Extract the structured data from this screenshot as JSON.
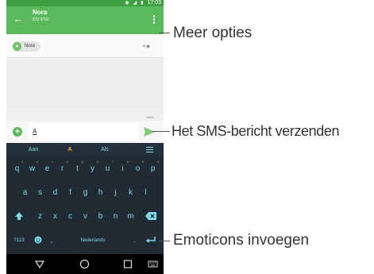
{
  "status_bar": {
    "time": "17:03"
  },
  "app_bar": {
    "contact_name": "Nora",
    "contact_number": "822 8766"
  },
  "recipient": {
    "name": "Nora",
    "avatar_icon": "person-icon"
  },
  "compose": {
    "counter": "160/1",
    "text": "A"
  },
  "keyboard": {
    "suggestions": [
      "Aan",
      "A",
      "Als"
    ],
    "row1": [
      {
        "key": "q",
        "num": "1"
      },
      {
        "key": "w",
        "num": "2"
      },
      {
        "key": "e",
        "num": "3"
      },
      {
        "key": "r",
        "num": "4"
      },
      {
        "key": "t",
        "num": "5"
      },
      {
        "key": "y",
        "num": "6"
      },
      {
        "key": "u",
        "num": "7"
      },
      {
        "key": "i",
        "num": "8"
      },
      {
        "key": "o",
        "num": "9"
      },
      {
        "key": "p",
        "num": "0"
      }
    ],
    "row2": [
      "a",
      "s",
      "d",
      "f",
      "g",
      "h",
      "j",
      "k",
      "l"
    ],
    "row3": [
      "z",
      "x",
      "c",
      "v",
      "b",
      "n",
      "m"
    ],
    "symbols_key": "?123",
    "comma_key": ",",
    "space_label": "Nederlands",
    "period_key": "."
  },
  "annotations": {
    "more_options": "Meer opties",
    "send_sms": "Het SMS-bericht verzenden",
    "insert_emoticons": "Emoticons invoegen"
  },
  "colors": {
    "accent_green": "#5bb85b",
    "status_green": "#3f9e3f",
    "keyboard_bg": "#1f2a33",
    "key_text": "#7fd9e8",
    "suggestion_highlight": "#f2b22b"
  }
}
